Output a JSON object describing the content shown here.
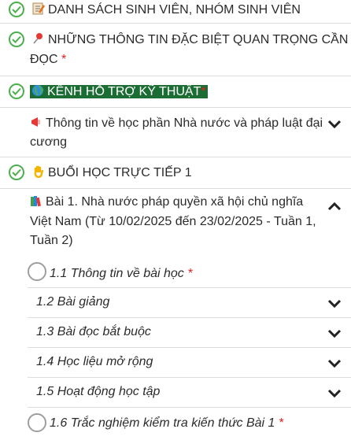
{
  "sections": {
    "danh_sach": {
      "title": "DANH SÁCH SINH VIÊN, NHÓM SINH VIÊN"
    },
    "thong_tin": {
      "title_line1": "NHỮNG THÔNG TIN ĐẶC BIỆT QUAN TRỌNG CẦN",
      "title_line2": "ĐỌC",
      "required": "*"
    },
    "kenh": {
      "title": "KÊNH HỖ TRỢ KỸ THUẬT",
      "required": "*"
    },
    "hoc_phan": {
      "title_line1": "Thông tin về học phần Nhà nước và pháp luật đại",
      "title_line2": "cương"
    },
    "buoi_hoc": {
      "title": "BUỔI HỌC TRỰC TIẾP 1"
    },
    "bai1": {
      "title_line1": "Bài 1. Nhà nước pháp quyền xã hội chủ nghĩa",
      "title_line2": "Việt Nam (Từ 10/02/2025 đến 23/02/2025 - Tuần 1,",
      "title_line3": "Tuần 2)"
    }
  },
  "items": {
    "i11": {
      "label": "1.1 Thông tin về bài học",
      "required": "*"
    },
    "i12": {
      "label": "1.2 Bài giảng"
    },
    "i13": {
      "label": "1.3 Bài đọc bắt buộc"
    },
    "i14": {
      "label": "1.4 Học liệu mở rộng"
    },
    "i15": {
      "label": "1.5 Hoạt động học tập"
    },
    "i16": {
      "label": "1.6 Trắc nghiệm kiểm tra kiến thức Bài 1",
      "required": "*"
    }
  },
  "colors": {
    "check": "#4caf50",
    "required": "#e02020",
    "highlight_bg": "#1b6d33"
  }
}
